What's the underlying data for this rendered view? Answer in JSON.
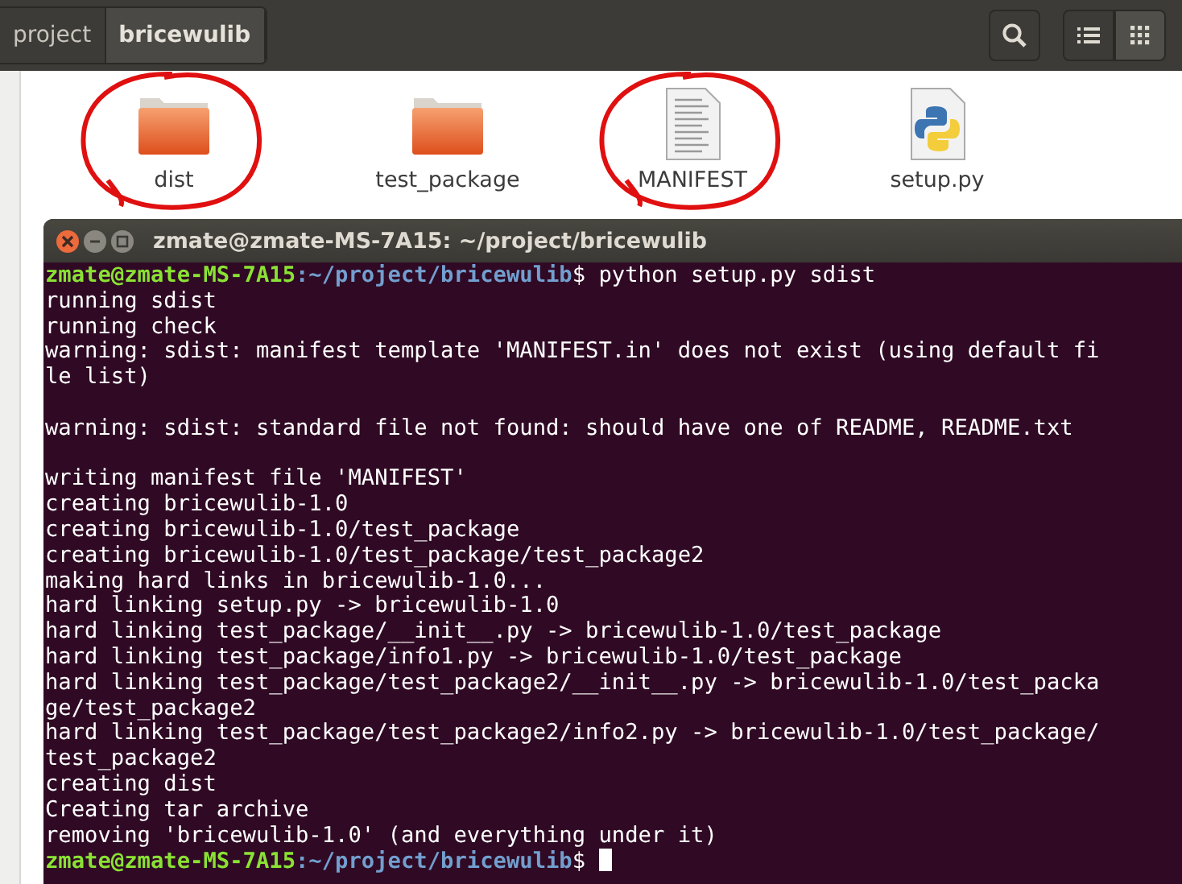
{
  "path_bar": [
    {
      "label": "project",
      "selected": false
    },
    {
      "label": "bricewulib",
      "selected": true
    }
  ],
  "view_buttons": [
    {
      "kind": "list",
      "selected": false
    },
    {
      "kind": "grid",
      "selected": true
    }
  ],
  "files": [
    {
      "name": "dist",
      "kind": "folder",
      "circled": true
    },
    {
      "name": "test_package",
      "kind": "folder",
      "circled": false
    },
    {
      "name": "MANIFEST",
      "kind": "text",
      "circled": true
    },
    {
      "name": "setup.py",
      "kind": "python",
      "circled": false
    }
  ],
  "terminal": {
    "title": "zmate@zmate-MS-7A15: ~/project/bricewulib",
    "lines": [
      {
        "kind": "prompt",
        "user": "zmate@zmate-MS-7A15",
        "path": ":~/project/bricewulib",
        "command": "$ python setup.py sdist",
        "cursor": false
      },
      {
        "kind": "output",
        "text": "running sdist"
      },
      {
        "kind": "output",
        "text": "running check"
      },
      {
        "kind": "output",
        "text": "warning: sdist: manifest template 'MANIFEST.in' does not exist (using default fi"
      },
      {
        "kind": "output",
        "text": "le list)"
      },
      {
        "kind": "blank"
      },
      {
        "kind": "output",
        "text": "warning: sdist: standard file not found: should have one of README, README.txt"
      },
      {
        "kind": "blank"
      },
      {
        "kind": "output",
        "text": "writing manifest file 'MANIFEST'"
      },
      {
        "kind": "output",
        "text": "creating bricewulib-1.0"
      },
      {
        "kind": "output",
        "text": "creating bricewulib-1.0/test_package"
      },
      {
        "kind": "output",
        "text": "creating bricewulib-1.0/test_package/test_package2"
      },
      {
        "kind": "output",
        "text": "making hard links in bricewulib-1.0..."
      },
      {
        "kind": "output",
        "text": "hard linking setup.py -> bricewulib-1.0"
      },
      {
        "kind": "output",
        "text": "hard linking test_package/__init__.py -> bricewulib-1.0/test_package"
      },
      {
        "kind": "output",
        "text": "hard linking test_package/info1.py -> bricewulib-1.0/test_package"
      },
      {
        "kind": "output",
        "text": "hard linking test_package/test_package2/__init__.py -> bricewulib-1.0/test_packa"
      },
      {
        "kind": "output",
        "text": "ge/test_package2"
      },
      {
        "kind": "output",
        "text": "hard linking test_package/test_package2/info2.py -> bricewulib-1.0/test_package/"
      },
      {
        "kind": "output",
        "text": "test_package2"
      },
      {
        "kind": "output",
        "text": "creating dist"
      },
      {
        "kind": "output",
        "text": "Creating tar archive"
      },
      {
        "kind": "output",
        "text": "removing 'bricewulib-1.0' (and everything under it)"
      },
      {
        "kind": "prompt",
        "user": "zmate@zmate-MS-7A15",
        "path": ":~/project/bricewulib",
        "command": "$ ",
        "cursor": true
      }
    ]
  }
}
